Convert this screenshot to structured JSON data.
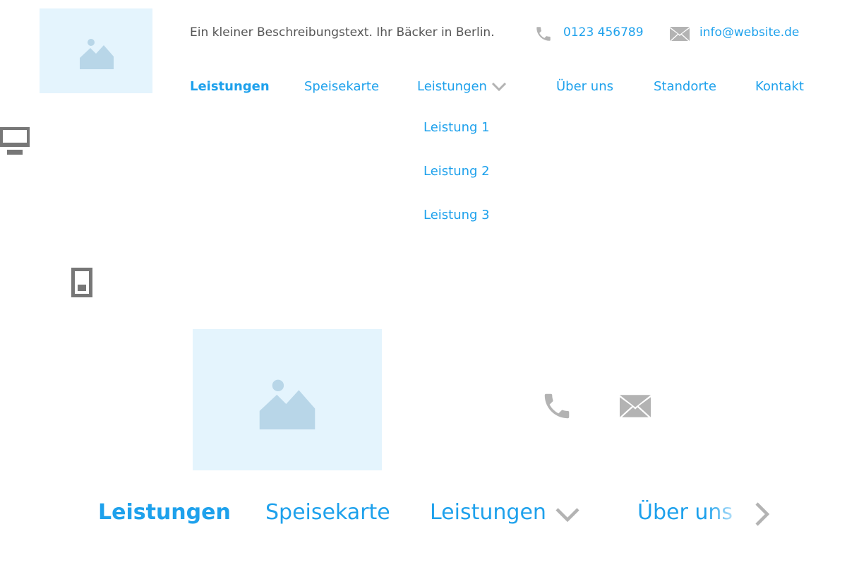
{
  "header": {
    "description": "Ein kleiner Beschreibungstext. Ihr Bäcker in Berlin.",
    "phone": "0123 456789",
    "email": "info@website.de",
    "logo_icon": "image-placeholder-icon"
  },
  "nav": {
    "items": [
      {
        "label": "Leistungen",
        "active": true
      },
      {
        "label": "Speisekarte",
        "active": false
      },
      {
        "label": "Leistungen",
        "active": false,
        "has_dropdown": true
      },
      {
        "label": "Über uns",
        "active": false
      },
      {
        "label": "Standorte",
        "active": false
      },
      {
        "label": "Kontakt",
        "active": false
      }
    ],
    "dropdown": [
      "Leistung 1",
      "Leistung 2",
      "Leistung 3"
    ]
  },
  "device_icons": {
    "desktop": "desktop-icon",
    "mobile": "mobile-icon"
  },
  "mobile_nav": {
    "items": [
      {
        "label": "Leistungen",
        "active": true
      },
      {
        "label": "Speisekarte",
        "active": false
      },
      {
        "label": "Leistungen",
        "active": false,
        "has_dropdown": true
      },
      {
        "label": "Über uns",
        "active": false
      }
    ]
  },
  "colors": {
    "accent": "#1ea1ec",
    "icon_gray": "#b3b3b3",
    "placeholder_bg": "#e4f4fd",
    "placeholder_fg": "#b8d6e8"
  }
}
